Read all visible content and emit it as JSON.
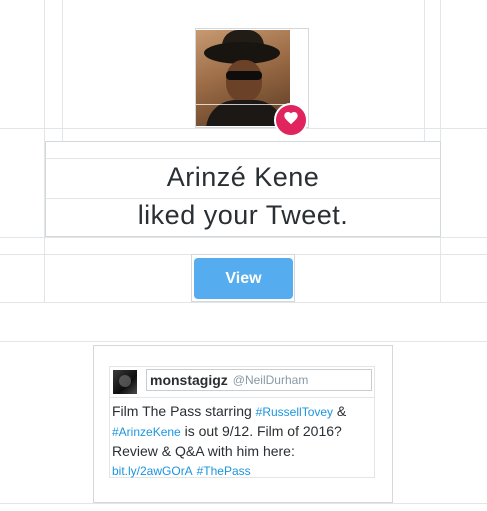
{
  "notification": {
    "liker_name": "Arinzé Kene",
    "action_text": "liked your Tweet.",
    "view_label": "View",
    "avatar_icon": "user-photo",
    "badge_icon": "heart-icon",
    "badge_color": "#e0245e",
    "button_color": "#55acee"
  },
  "tweet": {
    "author_name": "monstagigz",
    "author_handle": "@NeilDurham",
    "text_parts": [
      "Film The Pass starring ",
      "#RussellTovey",
      " & ",
      "#ArinzeKene",
      " is out 9/12. Film of 2016? Review & Q&A with him here: ",
      "bit.ly/2awGOrA",
      " ",
      "#ThePass"
    ],
    "link_color": "#1b95e0"
  }
}
